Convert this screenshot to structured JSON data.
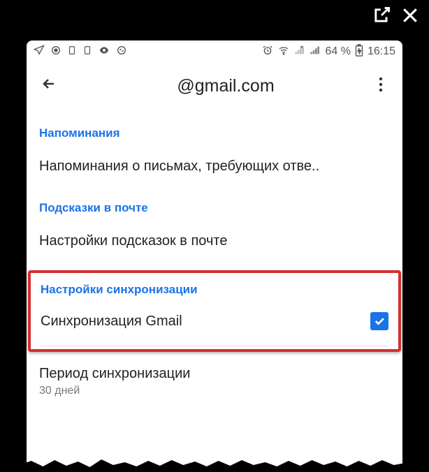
{
  "window": {
    "open_external_icon": "open-external-icon",
    "close_icon": "close-icon"
  },
  "status_bar": {
    "battery_percent": "64 %",
    "time": "16:15"
  },
  "app_bar": {
    "title": "@gmail.com"
  },
  "sections": {
    "reminders": {
      "header": "Напоминания",
      "item": "Напоминания о письмах, требующих отве.."
    },
    "hints": {
      "header": "Подсказки в почте",
      "item": "Настройки подсказок в почте"
    },
    "sync": {
      "header": "Настройки синхронизации",
      "item": "Синхронизация Gmail",
      "checked": true
    },
    "period": {
      "title": "Период синхронизации",
      "value": "30 дней"
    }
  }
}
